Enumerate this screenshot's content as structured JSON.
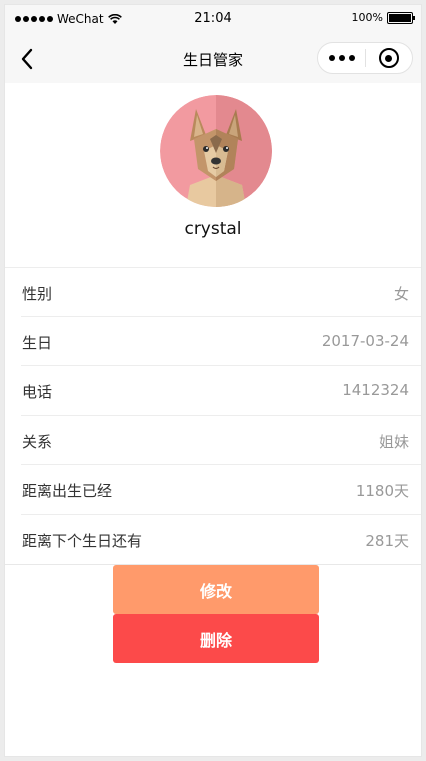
{
  "status_bar": {
    "carrier": "WeChat",
    "time": "21:04",
    "battery": "100%"
  },
  "nav": {
    "title": "生日管家",
    "back_icon": "chevron-left-icon",
    "more_icon": "more-dots-icon",
    "close_icon": "target-close-icon"
  },
  "profile": {
    "avatar_icon": "dog-avatar-icon",
    "name": "crystal"
  },
  "info": [
    {
      "label": "性别",
      "value": "女"
    },
    {
      "label": "生日",
      "value": "2017-03-24"
    },
    {
      "label": "电话",
      "value": "1412324"
    },
    {
      "label": "关系",
      "value": "姐妹"
    },
    {
      "label": "距离出生已经",
      "value": "1180天"
    },
    {
      "label": "距离下个生日还有",
      "value": "281天"
    }
  ],
  "actions": {
    "edit_label": "修改",
    "delete_label": "删除"
  },
  "colors": {
    "edit_button": "#ff9a6b",
    "delete_button": "#fc4a4a",
    "avatar_bg": "#f29aa0"
  }
}
